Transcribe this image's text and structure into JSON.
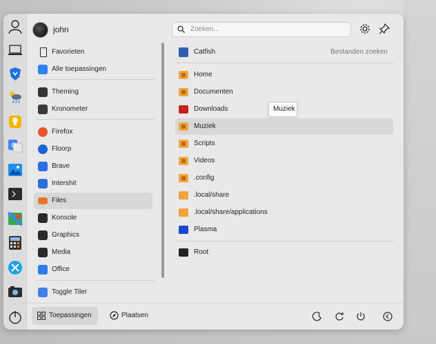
{
  "header": {
    "username": "john",
    "search_placeholder": "Zoeken...",
    "settings_icon": "gear-icon",
    "pin_icon": "pin-icon"
  },
  "favorites_bar": {
    "items": [
      {
        "name": "user-icon"
      },
      {
        "name": "laptop-icon"
      },
      {
        "name": "brave-icon"
      },
      {
        "name": "weather-icon"
      },
      {
        "name": "lightbulb-icon"
      },
      {
        "name": "translate-icon"
      },
      {
        "name": "image-viewer-icon"
      },
      {
        "name": "terminal-icon"
      },
      {
        "name": "maps-icon"
      },
      {
        "name": "calculator-icon"
      },
      {
        "name": "xtreme-icon"
      },
      {
        "name": "camera-icon"
      },
      {
        "name": "power-icon"
      }
    ]
  },
  "categories": [
    {
      "label": "Favorieten",
      "icon": "bookmark-icon"
    },
    {
      "label": "Alle toepassingen",
      "icon": "grid-icon"
    },
    {
      "label": "Theming",
      "icon": "theming-icon"
    },
    {
      "label": "Kronometer",
      "icon": "stopwatch-icon"
    },
    {
      "label": "Firefox",
      "icon": "firefox-icon"
    },
    {
      "label": "Floorp",
      "icon": "floorp-icon"
    },
    {
      "label": "Brave",
      "icon": "brave-icon"
    },
    {
      "label": "Intershit",
      "icon": "intershit-icon"
    },
    {
      "label": "Files",
      "icon": "files-icon"
    },
    {
      "label": "Konsole",
      "icon": "konsole-icon"
    },
    {
      "label": "Graphics",
      "icon": "graphics-icon"
    },
    {
      "label": "Media",
      "icon": "media-icon"
    },
    {
      "label": "Office",
      "icon": "office-icon"
    },
    {
      "label": "Toggle Tiler",
      "icon": "tiler-icon"
    }
  ],
  "places": {
    "top": {
      "label": "Catfish",
      "sublabel": "Bestanden zoeken",
      "icon": "catfish-icon"
    },
    "items": [
      {
        "label": "Home",
        "icon": "home-folder-icon"
      },
      {
        "label": "Documenten",
        "icon": "documents-folder-icon"
      },
      {
        "label": "Downloads",
        "icon": "downloads-folder-icon"
      },
      {
        "label": "Muziek",
        "icon": "music-folder-icon"
      },
      {
        "label": "Scripts",
        "icon": "scripts-folder-icon"
      },
      {
        "label": "Videos",
        "icon": "videos-folder-icon"
      },
      {
        "label": ".config",
        "icon": "config-folder-icon"
      },
      {
        "label": ".local/share",
        "icon": "folder-icon"
      },
      {
        "label": ".local/share/applications",
        "icon": "folder-icon"
      },
      {
        "label": "Plasma",
        "icon": "plasma-folder-icon"
      },
      {
        "label": "Root",
        "icon": "root-folder-icon"
      }
    ],
    "tooltip": "Muziek"
  },
  "footer": {
    "tabs": [
      {
        "label": "Toepassingen",
        "icon": "grid-icon"
      },
      {
        "label": "Plaatsen",
        "icon": "compass-icon"
      }
    ],
    "actions": [
      {
        "name": "sleep-icon"
      },
      {
        "name": "restart-icon"
      },
      {
        "name": "power-icon"
      },
      {
        "name": "logout-icon"
      }
    ]
  },
  "colors": {
    "menu_bg": "#e9e9e9",
    "highlight": "#d8d8d8",
    "folder_orange": "#f2a43a",
    "folder_red": "#c81f1f",
    "folder_blue": "#1847c8",
    "folder_dark": "#222222"
  }
}
